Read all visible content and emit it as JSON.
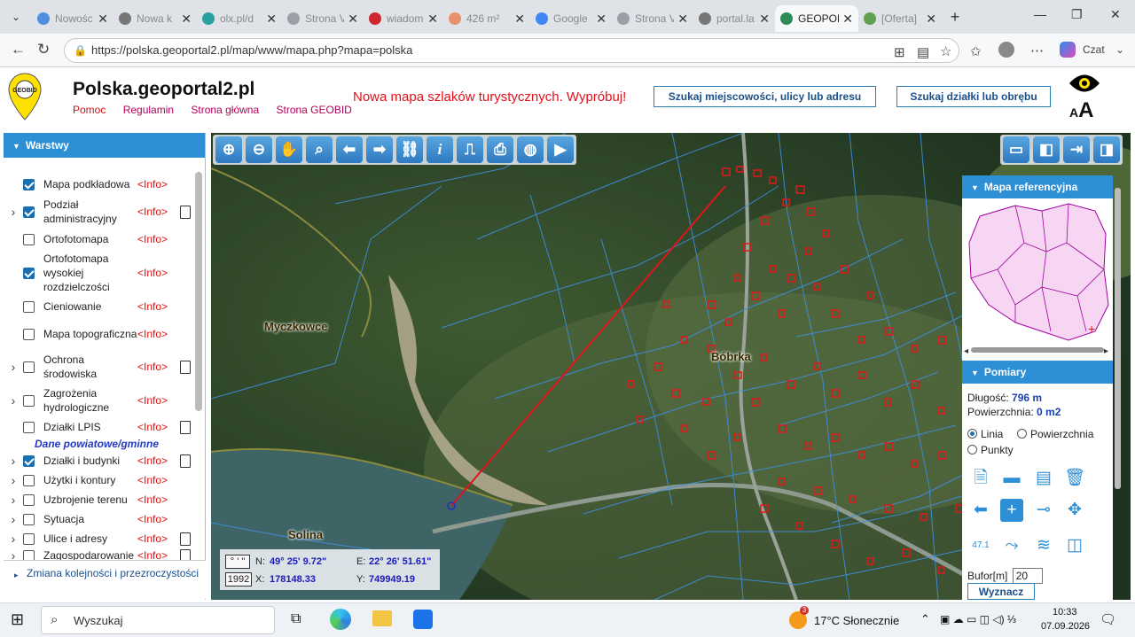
{
  "browser": {
    "tabs": [
      {
        "title": "Nowośc",
        "color": "#4f8fe0"
      },
      {
        "title": "Nowa k",
        "color": "#777777"
      },
      {
        "title": "olx.pl/d",
        "color": "#2aa0a0"
      },
      {
        "title": "Strona V",
        "color": "#9aa0a6"
      },
      {
        "title": "wiadom",
        "color": "#d0262d"
      },
      {
        "title": "426 m²",
        "color": "#e8916a"
      },
      {
        "title": "Google",
        "color": "#4285f4"
      },
      {
        "title": "Strona V",
        "color": "#9aa0a6"
      },
      {
        "title": "portal.la",
        "color": "#777777"
      },
      {
        "title": "GEOPOR",
        "color": "#2e8b57"
      },
      {
        "title": "[Oferta]",
        "color": "#60a050"
      }
    ],
    "active_tab": 9,
    "url": "https://polska.geoportal2.pl/map/www/mapa.php?mapa=polska",
    "czat_label": "Czat"
  },
  "header": {
    "logo_text": "GEOBID",
    "title": "Polska.geoportal2.pl",
    "links": [
      "Pomoc",
      "Regulamin",
      "Strona główna",
      "Strona GEOBID"
    ],
    "promo": "Nowa mapa szlaków turystycznych. Wypróbuj!",
    "search_address_btn": "Szukaj miejscowości, ulicy lub adresu",
    "search_parcel_btn": "Szukaj działki lub obrębu",
    "font_size_label": "AA"
  },
  "sidebar": {
    "title": "Warstwy",
    "layers": [
      {
        "name": "Mapa podkładowa",
        "checked": true,
        "expand": false,
        "doc": false
      },
      {
        "name": "Podział administracyjny",
        "checked": true,
        "expand": true,
        "doc": true
      },
      {
        "name": "Ortofotomapa",
        "checked": false,
        "expand": false,
        "doc": false
      },
      {
        "name": "Ortofotomapa wysokiej rozdzielczości",
        "checked": true,
        "expand": false,
        "doc": false
      },
      {
        "name": "Cieniowanie",
        "checked": false,
        "expand": false,
        "doc": false
      },
      {
        "name": "Mapa topograficzna",
        "checked": false,
        "expand": false,
        "doc": false
      },
      {
        "name": "Ochrona środowiska",
        "checked": false,
        "expand": true,
        "doc": true
      },
      {
        "name": "Zagrożenia hydrologiczne",
        "checked": false,
        "expand": true,
        "doc": false
      },
      {
        "name": "Działki LPIS",
        "checked": false,
        "expand": false,
        "doc": true
      }
    ],
    "section_label": "Dane powiatowe/gminne",
    "county_layers": [
      {
        "name": "Działki i budynki",
        "checked": true,
        "expand": true,
        "doc": true
      },
      {
        "name": "Użytki i kontury",
        "checked": false,
        "expand": true,
        "doc": false
      },
      {
        "name": "Uzbrojenie terenu",
        "checked": false,
        "expand": true,
        "doc": false
      },
      {
        "name": "Sytuacja",
        "checked": false,
        "expand": true,
        "doc": false
      },
      {
        "name": "Ulice i adresy",
        "checked": false,
        "expand": true,
        "doc": true
      },
      {
        "name": "Zagospodarowanie",
        "checked": false,
        "expand": true,
        "doc": true
      }
    ],
    "info_label": "<Info>",
    "footer": "Zmiana kolejności i przezroczystości"
  },
  "map": {
    "places": [
      "Myczkowce",
      "Bóbrka",
      "Solina"
    ],
    "coords": {
      "format_btn": "° ' \"",
      "crs_btn": "1992",
      "n_label": "N:",
      "n_value": "49° 25' 9.72\"",
      "e_label": "E:",
      "e_value": "22° 26' 51.61\"",
      "x_label": "X:",
      "x_value": "178148.33",
      "y_label": "Y:",
      "y_value": "749949.19"
    }
  },
  "ref_panel": {
    "title": "Mapa referencyjna"
  },
  "measure": {
    "title": "Pomiary",
    "length_label": "Długość:",
    "length_value": "796 m",
    "area_label": "Powierzchnia:",
    "area_value": "0 m2",
    "mode_options": [
      "Linia",
      "Powierzchnia",
      "Punkty"
    ],
    "selected_mode": "Linia",
    "buffer_label": "Bufor[m]",
    "buffer_value": "20",
    "calc_btn": "Wyznacz",
    "label_icon_text": "47.1"
  },
  "taskbar": {
    "search_placeholder": "Wyszukaj",
    "weather": "17°C  Słonecznie",
    "weather_badge": "3",
    "time": "10:33",
    "date": "07.09.2026"
  }
}
